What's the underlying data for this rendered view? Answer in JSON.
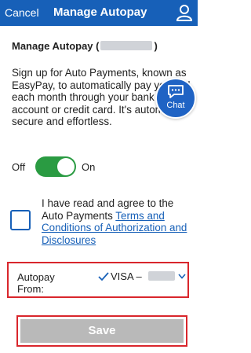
{
  "header": {
    "cancel_label": "Cancel",
    "title": "Manage Autopay",
    "user_icon": "user-icon"
  },
  "section": {
    "title_prefix": "Manage Autopay (",
    "title_suffix": ")"
  },
  "description": "Sign up for Auto Payments, known as EasyPay, to automatically pay your bill each month through your bank account or credit card. It's automatic, secure and effortless.",
  "chat": {
    "label": "Chat",
    "icon": "chat-bubble-icon"
  },
  "toggle": {
    "off_label": "Off",
    "on_label": "On",
    "state": "on"
  },
  "agreement": {
    "text": "I have read and agree to the Auto Payments ",
    "link": "Terms and Conditions of Authorization and Disclosures",
    "checked": false
  },
  "autopay_from": {
    "label": "Autopay From:",
    "value": "VISA –",
    "icon": "chevron-down-icon"
  },
  "save_label": "Save",
  "colors": {
    "header": "#1760b8",
    "toggle_on": "#2a9b42",
    "highlight": "#d9262c",
    "save_disabled": "#b9b9b9",
    "link": "#1760b8"
  }
}
